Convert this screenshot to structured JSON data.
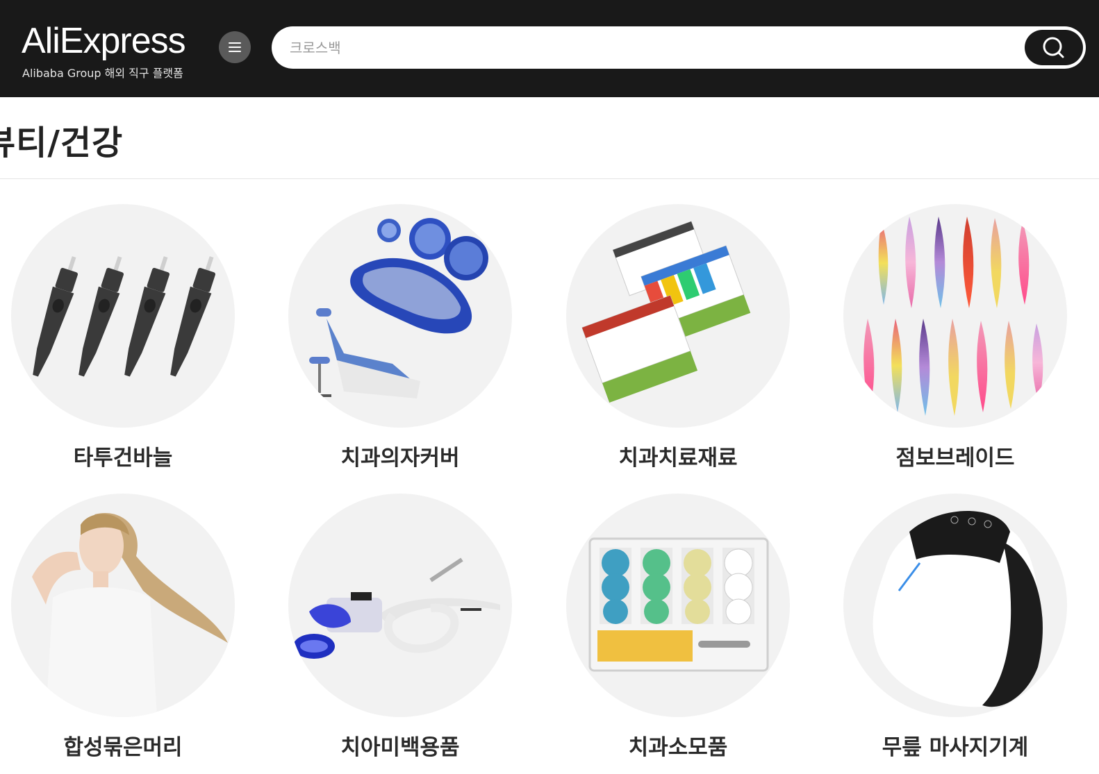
{
  "header": {
    "logo_text": "AliExpress",
    "tagline": "Alibaba Group 해외 직구 플랫폼",
    "search": {
      "placeholder": "크로스백",
      "value": ""
    }
  },
  "page": {
    "title": "뷰티/건강"
  },
  "categories": [
    {
      "label": "타투건바늘",
      "icon": "tattoo-needle-cartridges"
    },
    {
      "label": "치과의자커버",
      "icon": "dental-chair-cover"
    },
    {
      "label": "치과치료재료",
      "icon": "absorbent-paper-points"
    },
    {
      "label": "점보브레이드",
      "icon": "jumbo-braid-hair"
    },
    {
      "label": "합성묶은머리",
      "icon": "synthetic-ponytail"
    },
    {
      "label": "치아미백용품",
      "icon": "teeth-whitening-lamp"
    },
    {
      "label": "치과소모품",
      "icon": "polishing-discs"
    },
    {
      "label": "무릎 마사지기계",
      "icon": "knee-massager"
    }
  ],
  "colors": {
    "header_bg": "#191919",
    "page_bg": "#ffffff",
    "circle_bg": "#f2f2f2"
  }
}
